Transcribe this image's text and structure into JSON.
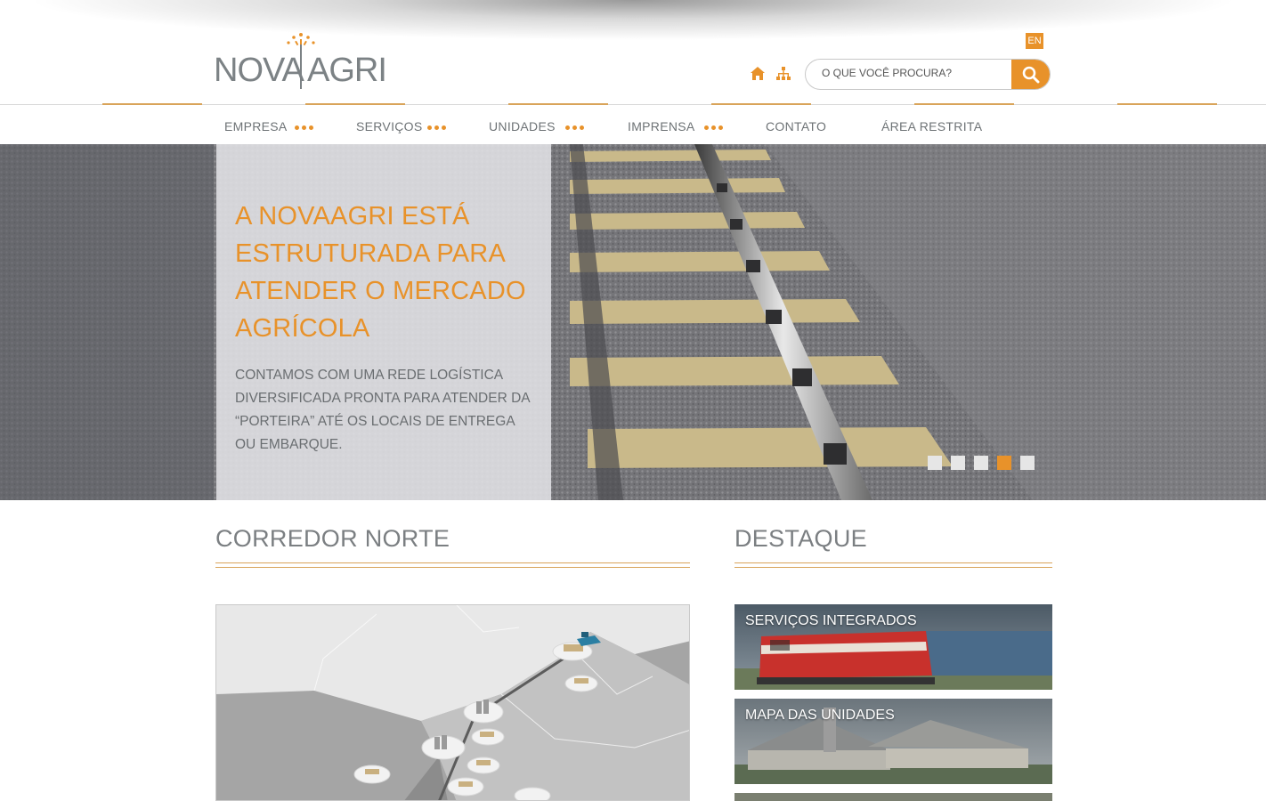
{
  "header": {
    "logo": {
      "left": "NOVA",
      "right": "AGRI"
    },
    "lang_label": "EN",
    "search": {
      "placeholder": "O QUE VOCÊ PROCURA?"
    },
    "icons": [
      "home-icon",
      "sitemap-icon",
      "search-icon"
    ]
  },
  "nav": {
    "items": [
      {
        "label": "EMPRESA",
        "submenu": true
      },
      {
        "label": "SERVIÇOS",
        "submenu": true
      },
      {
        "label": "UNIDADES",
        "submenu": true
      },
      {
        "label": "IMPRENSA",
        "submenu": true
      },
      {
        "label": "CONTATO",
        "submenu": false
      },
      {
        "label": "ÁREA RESTRITA",
        "submenu": false
      }
    ]
  },
  "hero": {
    "title": "A NOVAAGRI ESTÁ ESTRUTURADA PARA ATENDER O MERCADO AGRÍCOLA",
    "text": "CONTAMOS COM UMA REDE LOGÍSTICA DIVERSIFICADA PRONTA PARA ATENDER DA “PORTEIRA” ATÉ OS LOCAIS DE ENTREGA OU EMBARQUE.",
    "slides": 5,
    "active_slide": 4
  },
  "sections": {
    "corredor": {
      "title": "CORREDOR NORTE"
    },
    "destaque": {
      "title": "DESTAQUE",
      "cards": [
        {
          "label": "SERVIÇOS INTEGRADOS"
        },
        {
          "label": "MAPA DAS UNIDADES"
        }
      ]
    }
  },
  "colors": {
    "accent": "#e8922a",
    "text_gray": "#7b7f82",
    "rule": "#d9a45a"
  }
}
